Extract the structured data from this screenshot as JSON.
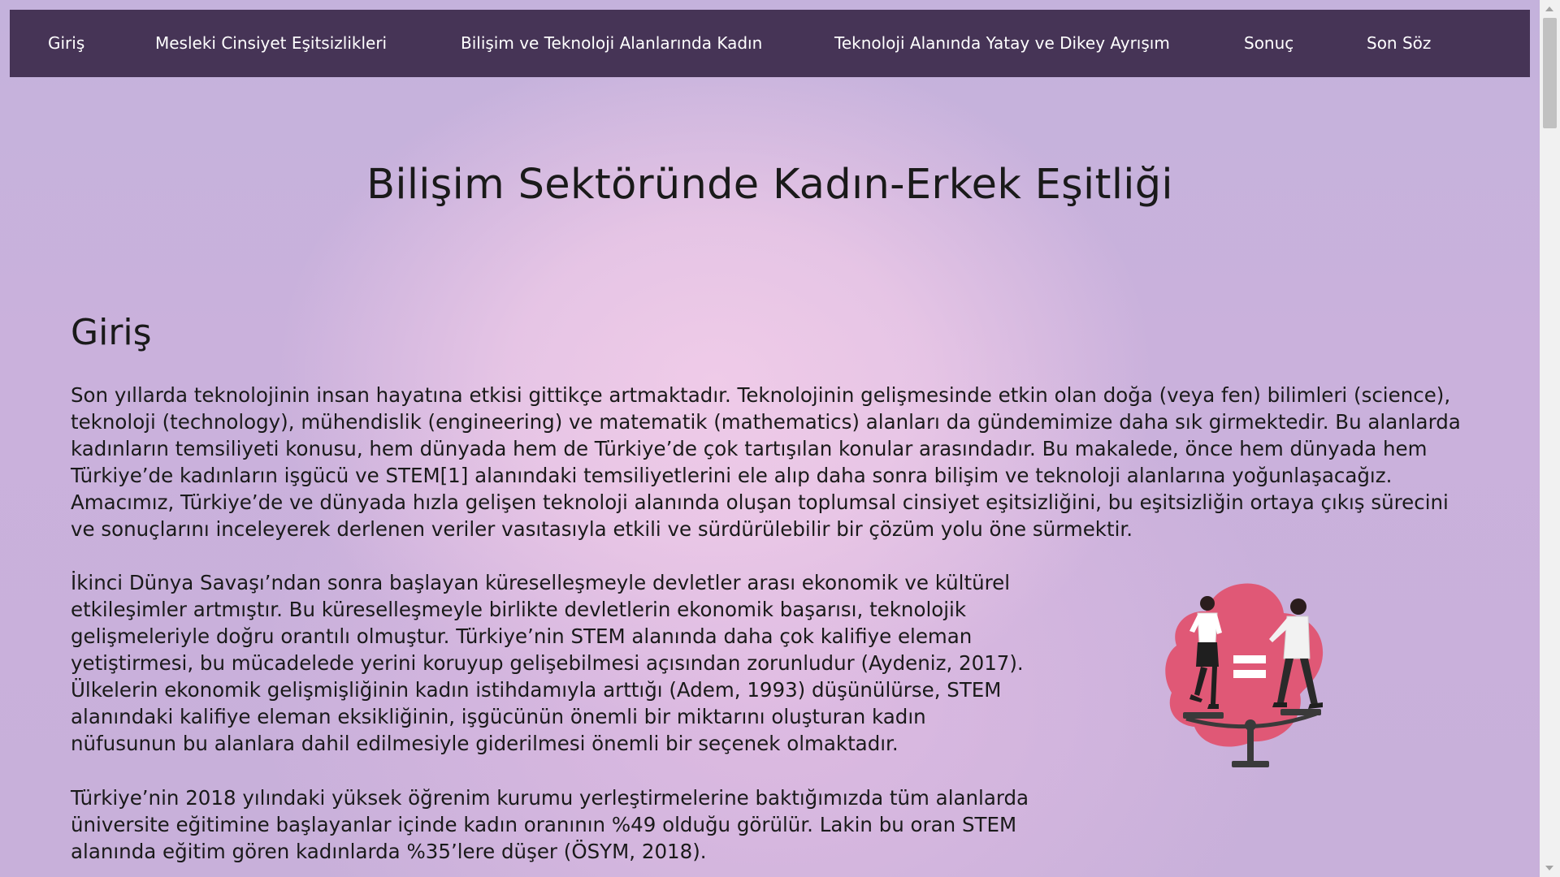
{
  "nav": {
    "items": [
      {
        "label": "Giriş"
      },
      {
        "label": "Mesleki Cinsiyet Eşitsizlikleri"
      },
      {
        "label": "Bilişim ve Teknoloji Alanlarında Kadın"
      },
      {
        "label": "Teknoloji Alanında Yatay ve Dikey Ayrışım"
      },
      {
        "label": "Sonuç"
      },
      {
        "label": "Son Söz"
      }
    ]
  },
  "page": {
    "title": "Bilişim Sektöründe Kadın-Erkek Eşitliği"
  },
  "section": {
    "heading": "Giriş",
    "paragraphs": [
      "Son yıllarda teknolojinin insan hayatına etkisi gittikçe artmaktadır. Teknolojinin gelişmesinde etkin olan doğa (veya fen) bilimleri (science), teknoloji (technology), mühendislik (engineering) ve matematik (mathematics) alanları da gündemimize daha sık girmektedir. Bu alanlarda kadınların temsiliyeti konusu, hem dünyada hem de Türkiye’de çok tartışılan konular arasındadır. Bu makalede, önce hem dünyada hem Türkiye’de kadınların işgücü ve STEM[1] alanındaki temsiliyetlerini ele alıp daha sonra bilişim ve teknoloji alanlarına yoğunlaşacağız. Amacımız, Türkiye’de ve dünyada hızla gelişen teknoloji alanında oluşan toplumsal cinsiyet eşitsizliğini, bu eşitsizliğin ortaya çıkış sürecini ve sonuçlarını inceleyerek derlenen veriler vasıtasıyla etkili ve sürdürülebilir bir çözüm yolu öne sürmektir.",
      "İkinci Dünya Savaşı’ndan sonra başlayan küreselleşmeyle devletler arası ekonomik ve kültürel etkileşimler artmıştır. Bu küreselleşmeyle birlikte devletlerin ekonomik başarısı, teknolojik gelişmeleriyle doğru orantılı olmuştur. Türkiye’nin STEM alanında daha çok kalifiye eleman yetiştirmesi, bu mücadelede yerini koruyup gelişebilmesi açısından zorunludur (Aydeniz, 2017). Ülkelerin ekonomik gelişmişliğinin kadın istihdamıyla arttığı (Adem, 1993) düşünülürse, STEM alanındaki kalifiye eleman eksikliğinin, işgücünün önemli bir miktarını oluşturan kadın nüfusunun bu alanlara dahil edilmesiyle giderilmesi önemli bir seçenek olmaktadır.",
      "Türkiye’nin 2018 yılındaki yüksek öğrenim kurumu yerleştirmelerine baktığımızda tüm alanlarda üniversite eğitimine başlayanlar içinde kadın oranının %49 olduğu görülür. Lakin bu oran STEM alanında eğitim gören kadınlarda %35’lere düşer (ÖSYM, 2018)."
    ]
  },
  "illustration": {
    "icon": "gender-equality-scale-icon",
    "colors": {
      "blob": "#e05876",
      "equals": "#ffffff",
      "scale": "#3a3a3a"
    }
  }
}
